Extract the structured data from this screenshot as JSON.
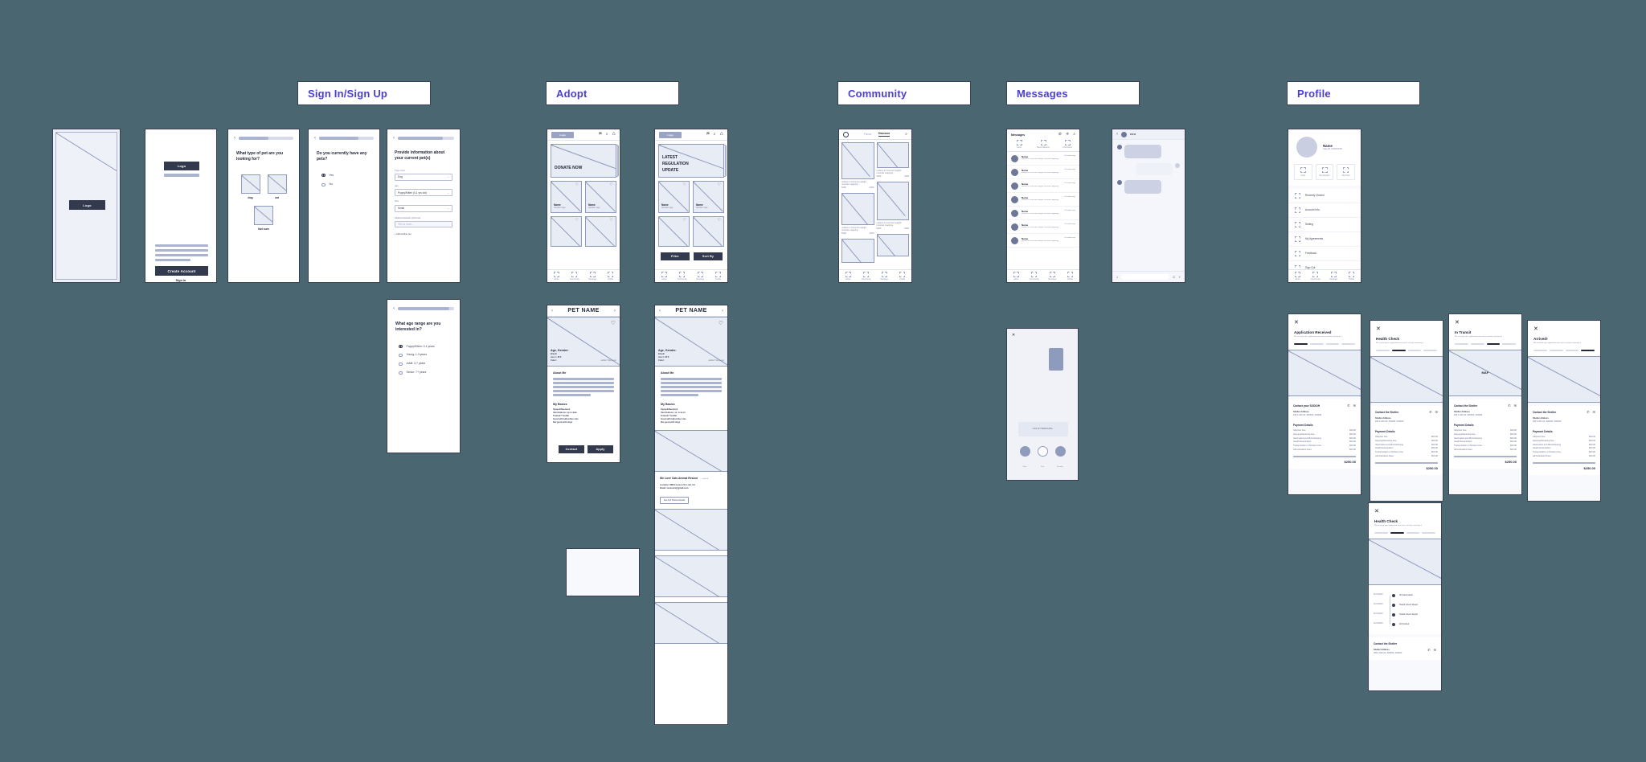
{
  "sections": [
    {
      "label": "Sign In/Sign Up"
    },
    {
      "label": "Adopt"
    },
    {
      "label": "Community"
    },
    {
      "label": "Messages"
    },
    {
      "label": "Profile"
    }
  ],
  "splash": {
    "name": "splash-screen",
    "logo_label": "Logo"
  },
  "signup": {
    "logo_label": "Logo",
    "create_account_label": "Create Account",
    "signin_label": "Sign In"
  },
  "pet_type": {
    "question": "What type of pet are you looking for?",
    "options": [
      "dog",
      "cat",
      "Not sure"
    ]
  },
  "current_pets": {
    "question": "Do you currently have any pets?",
    "options": [
      "Yes",
      "No"
    ],
    "selected": "Yes"
  },
  "pet_info": {
    "title": "Provide information about your current pet(s)",
    "fields": [
      {
        "label": "Type of pet",
        "value": "Dog"
      },
      {
        "label": "Age",
        "value": "Puppy/Kitten (0-1 yrs old)"
      },
      {
        "label": "Size",
        "value": "Small"
      }
    ],
    "extra_label": "Additional Details (Optional)",
    "extra_placeholder": "Tell us more...",
    "add_label": "+ Add another pet"
  },
  "age_range": {
    "question": "What age range are you interested in?",
    "options": [
      "Puppy/Kitten: 0-1 years",
      "Young: 1-3 years",
      "Adult: 3-7 years",
      "Senior: 7+ years"
    ],
    "selected": "Puppy/Kitten: 0-1 years"
  },
  "adopt_home": {
    "logo_label": "Logo",
    "icons": [
      "map-icon",
      "search-icon",
      "bell-icon"
    ],
    "banner_text": "DONATE NOW",
    "cards": [
      {
        "name": "Name",
        "meta": "Gender, Age"
      },
      {
        "name": "Name",
        "meta": "Gender, Age"
      },
      {
        "name": "Name",
        "meta": "Gender, Age"
      },
      {
        "name": "Name",
        "meta": "Gender, Age"
      }
    ],
    "tabs": [
      "Adopt",
      "Community",
      "Message",
      "Profile"
    ]
  },
  "adopt_list": {
    "logo_label": "Logo",
    "banner_text": "LATEST REGULATION UPDATE",
    "cards": [
      {
        "name": "Name",
        "meta": "Gender, Age"
      },
      {
        "name": "Name",
        "meta": "Gender, Age"
      }
    ],
    "filter_label": "Filter",
    "sort_label": "Sort By",
    "tabs": [
      "Adopt",
      "Community",
      "Message",
      "Profile"
    ]
  },
  "pet_detail_a": {
    "title": "PET NAME",
    "age_gender": "Age, Gender:",
    "breed_label": "Breed:",
    "size_label": "size: L M S",
    "color_label": "Color:",
    "added": "added *days ago",
    "about_title": "About Me",
    "basics_title": "My Basics",
    "basics": [
      "Spayed/Neutered",
      "Vaccinations: up to date",
      "Trained? Yes/No",
      "Good with kids/other cats",
      "Not good with dogs"
    ],
    "contact_label": "Contact",
    "apply_label": "Apply"
  },
  "pet_detail_b": {
    "title": "PET NAME",
    "age_gender": "Age, Gender:",
    "breed_label": "Breed:",
    "size_label": "size: L M S",
    "color_label": "Color:",
    "added": "added *days ago",
    "about_title": "About Me",
    "basics_title": "My Basics",
    "basics": [
      "Spayed/Neutered",
      "Vaccinations: xx, xx & xx",
      "Trained? Yes/No",
      "Good with kids/other cats",
      "Not good with dogs"
    ],
    "rescue_name": "We Love Cats Animal Rescue",
    "rescue_verified": "✓ Verified",
    "rescue_location": "Location: 888 N Lemon St, Lodi, CA",
    "rescue_email": "Email: xxxxxxxx@gmail.com",
    "rescue_btn": "See Full Shelter Details"
  },
  "community": {
    "tabs": [
      "Follow",
      "Discover"
    ],
    "active_tab": "Discover",
    "post_text": "umbers in Common weight nomclav mapping...",
    "like_count": "5200",
    "comment_count": "2200",
    "bottom_tabs": [
      "Adopt",
      "Community",
      "Message",
      "Profile"
    ]
  },
  "messages": {
    "title": "Messages",
    "icons": [
      "no-disturb-icon",
      "add-icon",
      "search-icon"
    ],
    "tabs": [
      "Likes",
      "New Followers",
      "Comments"
    ],
    "rows": [
      {
        "name": "Name",
        "preview": "umbers in Common weight nomclav mapping...",
        "time": "10 months ago"
      },
      {
        "name": "Name",
        "preview": "umbers in Common weight nomclav mapping...",
        "time": "10 months ago"
      },
      {
        "name": "Name",
        "preview": "umbers in Common weight nomclav mapping...",
        "time": "10 months ago"
      },
      {
        "name": "Name",
        "preview": "umbers in Common weight nomclav mapping...",
        "time": "10 months ago"
      },
      {
        "name": "Name",
        "preview": "umbers in Common weight nomclav mapping...",
        "time": "10 months ago"
      },
      {
        "name": "Name",
        "preview": "umbers in Common weight nomclav mapping...",
        "time": "10 months ago"
      },
      {
        "name": "Name",
        "preview": "umbers in Common weight nomclav mapping...",
        "time": "10 months ago"
      }
    ],
    "bottom_tabs": [
      "Adopt",
      "Community",
      "Message",
      "Profile"
    ]
  },
  "chat": {
    "title": "xxx",
    "more_icon": "more-icon",
    "input_icons": [
      "mic-icon",
      "emoji-icon",
      "plus-icon"
    ]
  },
  "chat_call": {
    "status": "LOG IN TRANSLATE...",
    "actions": [
      "mute-icon",
      "end-call-icon",
      "speaker-icon"
    ],
    "labels": [
      "Mute",
      "End",
      "Speaker"
    ]
  },
  "profile": {
    "name": "Name",
    "user_id": "User ID: XXXXXXXX",
    "stats": [
      {
        "label": "Liked"
      },
      {
        "label": "My Adoption"
      },
      {
        "label": "My Posts"
      }
    ],
    "menu": [
      {
        "label": "Recently Viewed",
        "icon": "clock-icon"
      },
      {
        "label": "Account Info",
        "icon": "user-icon"
      },
      {
        "label": "Setting",
        "icon": "gear-icon"
      },
      {
        "label": "My Agreements",
        "icon": "doc-icon"
      },
      {
        "label": "Feedback",
        "icon": "chat-icon"
      },
      {
        "label": "Sign Out",
        "icon": "exit-icon"
      }
    ],
    "bottom_tabs": [
      "Adopt",
      "Community",
      "Message",
      "Profile"
    ]
  },
  "status_cards": [
    {
      "title": "Application Received",
      "subtitle": "We received your application from and is actively reviewing it",
      "step": 0,
      "contact_title": "Contact your SODIOH",
      "shelter_label": "Shelter Address",
      "shelter_address": "### # ### ##, ######, ######",
      "map_label": "",
      "pay_title": "Payment Details",
      "items": [
        {
          "label": "Adoption Fee",
          "value": "$00.00"
        },
        {
          "label": "Spaying/Neutering Fee",
          "value": "$00.00"
        },
        {
          "label": "Vaccination and Microchipping",
          "value": "$00.00"
        },
        {
          "label": "Health Examination",
          "value": "$00.00"
        },
        {
          "label": "Transportation or Delivery Fee",
          "value": "$00.00"
        },
        {
          "label": "Administrative Fees",
          "value": "$00.00"
        }
      ],
      "total": "$250.00"
    },
    {
      "title": "Health Check",
      "subtitle": "We received your application from and is actively reviewing it",
      "step": 1,
      "contact_title": "Contact the Shelter",
      "shelter_label": "Shelter Address",
      "shelter_address": "### # ### ##, ######, ######",
      "map_label": "",
      "pay_title": "Payment Details",
      "items": [
        {
          "label": "Adoption Fee",
          "value": "$00.00"
        },
        {
          "label": "Spaying/Neutering Fee",
          "value": "$00.00"
        },
        {
          "label": "Vaccination and Microchipping",
          "value": "$00.00"
        },
        {
          "label": "Health Examination",
          "value": "$00.00"
        },
        {
          "label": "Transportation or Delivery Fee",
          "value": "$00.00"
        },
        {
          "label": "Administrative Fees",
          "value": "$00.00"
        }
      ],
      "total": "$250.00"
    },
    {
      "title": "In Transit",
      "subtitle": "We received your application from and is actively reviewing it",
      "step": 2,
      "contact_title": "Contact the Shelter",
      "shelter_label": "Shelter Address",
      "shelter_address": "### # ### ##, ######, ######",
      "map_label": "MAP",
      "pay_title": "Payment Details",
      "items": [
        {
          "label": "Adoption Fee",
          "value": "$00.00"
        },
        {
          "label": "Spaying/Neutering Fee",
          "value": "$00.00"
        },
        {
          "label": "Vaccination and Microchipping",
          "value": "$00.00"
        },
        {
          "label": "Health Examination",
          "value": "$00.00"
        },
        {
          "label": "Transportation or Delivery Fee",
          "value": "$00.00"
        },
        {
          "label": "Administrative Fees",
          "value": "$00.00"
        }
      ],
      "total": "$250.00"
    },
    {
      "title": "Arrived!",
      "subtitle": "We received your application from and is actively reviewing it",
      "step": 3,
      "contact_title": "Contact the Shelter",
      "shelter_label": "Shelter Address",
      "shelter_address": "### # ### ##, ######, ######",
      "map_label": "",
      "pay_title": "Payment Details",
      "items": [
        {
          "label": "Adoption Fee",
          "value": "$00.00"
        },
        {
          "label": "Spaying/Neutering Fee",
          "value": "$00.00"
        },
        {
          "label": "Vaccination and Microchipping",
          "value": "$00.00"
        },
        {
          "label": "Health Examination",
          "value": "$00.00"
        },
        {
          "label": "Transportation or Delivery Fee",
          "value": "$00.00"
        },
        {
          "label": "Administrative Fees",
          "value": "$00.00"
        }
      ],
      "total": "$250.00"
    }
  ],
  "health_timeline": {
    "title": "Health Check",
    "subtitle": "We received your application from and is actively reviewing it",
    "step": 1,
    "events": [
      {
        "date": "01/01/2020",
        "label": "3rd Vaccination"
      },
      {
        "date": "01/01/2020",
        "label": "Health Check Report"
      },
      {
        "date": "01/01/2020",
        "label": "Health Check Report"
      },
      {
        "date": "01/01/2020",
        "label": "All finished"
      }
    ],
    "contact_title": "Contact the Shelter",
    "shelter_label": "Shelter Address",
    "shelter_address": "### # ### ##, ######, ######"
  },
  "colors": {
    "canvas": "#4a6670",
    "accent": "#4a3fd4",
    "ink": "#23283a",
    "frame": "#3b3f55",
    "wire": "#8f9bbd",
    "fill": "#e8ecf5"
  }
}
